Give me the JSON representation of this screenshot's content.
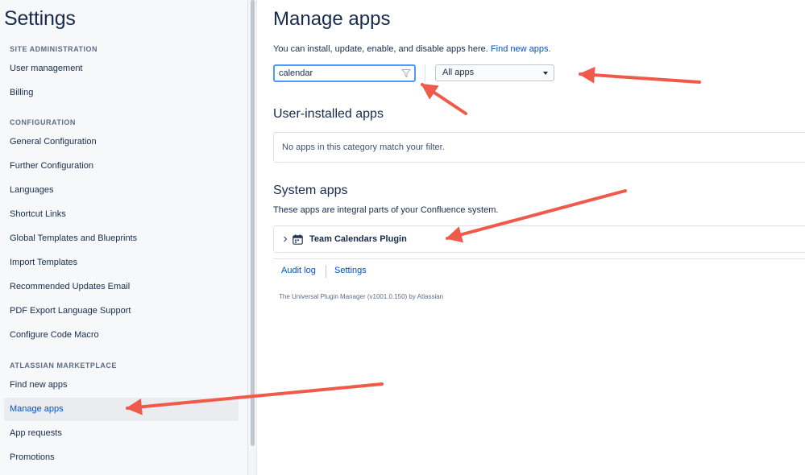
{
  "sidebar": {
    "title": "Settings",
    "sections": {
      "site_admin": "SITE ADMINISTRATION",
      "configuration": "CONFIGURATION",
      "marketplace": "ATLASSIAN MARKETPLACE"
    },
    "items": {
      "user_management": "User management",
      "billing": "Billing",
      "general_configuration": "General Configuration",
      "further_configuration": "Further Configuration",
      "languages": "Languages",
      "shortcut_links": "Shortcut Links",
      "global_templates": "Global Templates and Blueprints",
      "import_templates": "Import Templates",
      "recommended_updates": "Recommended Updates Email",
      "pdf_export": "PDF Export Language Support",
      "configure_code_macro": "Configure Code Macro",
      "find_new_apps": "Find new apps",
      "manage_apps": "Manage apps",
      "app_requests": "App requests",
      "promotions": "Promotions"
    },
    "active_item": "manage_apps"
  },
  "main": {
    "title": "Manage apps",
    "intro_text": "You can install, update, enable, and disable apps here.",
    "intro_link": "Find new apps.",
    "filter": {
      "value": "calendar",
      "icon": "filter-icon"
    },
    "app_type_select": {
      "selected": "All apps"
    },
    "user_installed": {
      "heading": "User-installed apps",
      "empty_message": "No apps in this category match your filter."
    },
    "system_apps": {
      "heading": "System apps",
      "description": "These apps are integral parts of your Confluence system.",
      "apps": [
        {
          "name": "Team Calendars Plugin",
          "icon": "calendar-icon"
        }
      ]
    },
    "footer": {
      "audit_log": "Audit log",
      "settings": "Settings",
      "credit": "The Universal Plugin Manager (v1001.0.150) by Atlassian"
    }
  },
  "annotation_color": "#f05a4a",
  "accent_color": "#0052cc"
}
